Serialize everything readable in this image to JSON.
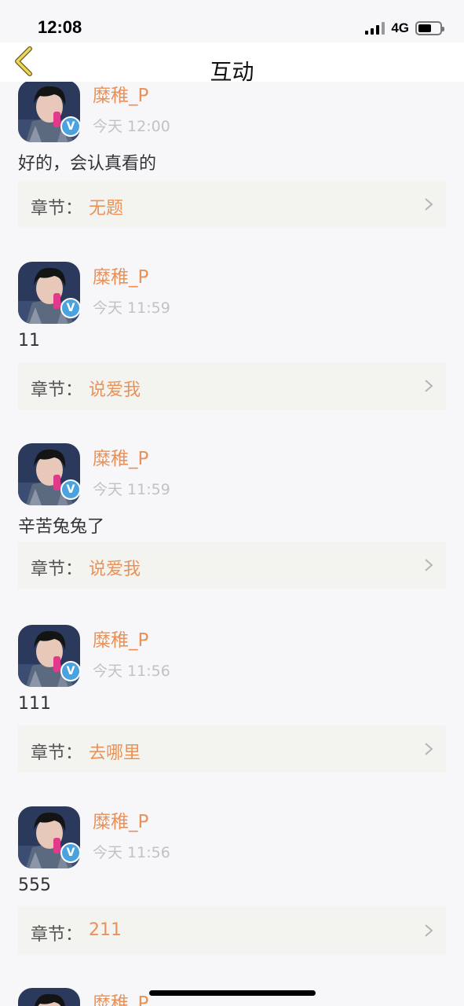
{
  "status_bar": {
    "time": "12:08",
    "network": "4G"
  },
  "nav": {
    "title": "互动",
    "back_icon": "chevron-left-icon"
  },
  "colors": {
    "accent": "#e8925a",
    "verified": "#4aa3df",
    "chapter_bg": "#f3f4ef"
  },
  "comments": [
    {
      "user": "糜稚_P",
      "time": "今天 12:00",
      "text": "好的，会认真看的",
      "chapter_prefix": "章节：",
      "chapter": "无题"
    },
    {
      "user": "糜稚_P",
      "time": "今天 11:59",
      "text": "11",
      "chapter_prefix": "章节：",
      "chapter": "说爱我"
    },
    {
      "user": "糜稚_P",
      "time": "今天 11:59",
      "text": "辛苦兔兔了",
      "chapter_prefix": "章节：",
      "chapter": "说爱我"
    },
    {
      "user": "糜稚_P",
      "time": "今天 11:56",
      "text": "111",
      "chapter_prefix": "章节：",
      "chapter": "去哪里"
    },
    {
      "user": "糜稚_P",
      "time": "今天 11:56",
      "text": "555",
      "chapter_prefix": "章节：",
      "chapter": "211"
    },
    {
      "user": "糜稚_P",
      "time": "",
      "text": "",
      "chapter_prefix": "",
      "chapter": ""
    }
  ]
}
